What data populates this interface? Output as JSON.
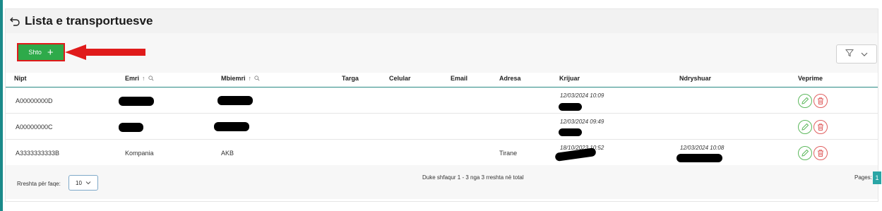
{
  "page": {
    "title": "Lista e transportuesve"
  },
  "toolbar": {
    "add_label": "Shto",
    "add_icon": "plus-icon",
    "filter_icon": "funnel-icon",
    "annotation_color": "#e01b1b"
  },
  "table": {
    "columns": {
      "nipt": "Nipt",
      "emri": "Emri",
      "mbiemri": "Mbiemri",
      "targa": "Targa",
      "celular": "Celular",
      "email": "Email",
      "adresa": "Adresa",
      "krijuar": "Krijuar",
      "ndryshuar": "Ndryshuar",
      "veprime": "Veprime"
    },
    "rows": [
      {
        "nipt": "A00000000D",
        "emri": "",
        "mbiemri": "",
        "adresa": "",
        "krijuar": "12/03/2024 10:09",
        "ndryshuar": ""
      },
      {
        "nipt": "A00000000C",
        "emri": "",
        "mbiemri": "",
        "adresa": "",
        "krijuar": "12/03/2024 09:49",
        "ndryshuar": ""
      },
      {
        "nipt": "A3333333333B",
        "emri": "Kompania",
        "mbiemri": "AKB",
        "adresa": "Tirane",
        "krijuar": "18/10/2023 10:52",
        "ndryshuar": "12/03/2024 10:08"
      }
    ]
  },
  "footer": {
    "rows_per_page_label": "Rreshta për faqe:",
    "rows_per_page_value": "10",
    "info": "Duke shfaqur 1 - 3 nga 3 rreshta në total",
    "pages_label": "Pages:",
    "current_page": "1"
  },
  "colors": {
    "accent": "#2aa5a5",
    "add_button": "#2eaa4a",
    "edit": "#5cb85c",
    "delete": "#e06060"
  }
}
